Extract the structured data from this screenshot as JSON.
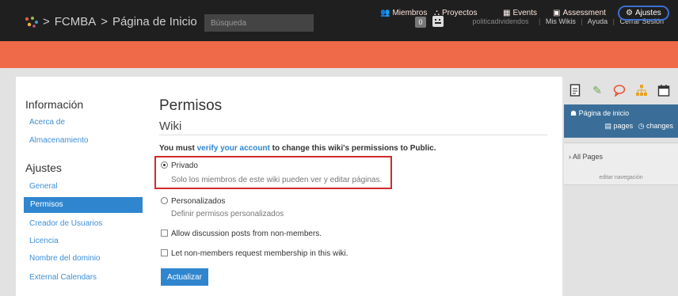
{
  "topbar": {
    "breadcrumb": [
      ">",
      "FCMBA",
      ">",
      "Página de Inicio"
    ],
    "search_placeholder": "Búsqueda",
    "notification_count": "0",
    "username": "politicadividendos",
    "links": [
      "Mis Wikis",
      "Ayuda",
      "Cerrar Sesión"
    ]
  },
  "nav": {
    "items": [
      "Miembros",
      "Proyectos",
      "Events",
      "Assessment",
      "Ajustes"
    ],
    "active": "Ajustes"
  },
  "sidebar": {
    "section1": "Información",
    "section1_items": [
      "Acerca de",
      "Almacenamiento"
    ],
    "section2": "Ajustes",
    "section2_items": [
      "General",
      "Permisos",
      "Creador de Usuarios",
      "Licencia",
      "Nombre del dominio",
      "External Calendars"
    ],
    "active": "Permisos"
  },
  "main": {
    "title": "Permisos",
    "subtitle": "Wiki",
    "notice_pre": "You must",
    "notice_link": "verify your account",
    "notice_post": "to change this wiki's permissions to Public.",
    "options": [
      {
        "label": "Privado",
        "description": "Solo los miembros de este wiki pueden ver y editar páginas.",
        "selected": true
      },
      {
        "label": "Personalizados",
        "description": "Definir permisos personalizados",
        "selected": false
      }
    ],
    "checkboxes": [
      {
        "label": "Allow discussion posts from non-members.",
        "checked": false
      },
      {
        "label": "Let non-members request membership in this wiki.",
        "checked": false
      }
    ],
    "submit_label": "Actualizar",
    "highlight_color": "#d12a2a"
  },
  "right_panel": {
    "icons": [
      "page-icon",
      "paperclip-icon",
      "speech-bubble-icon",
      "sitemap-icon",
      "calendar-icon"
    ],
    "home_label": "Página de inicio",
    "pages_label": "pages",
    "changes_label": "changes",
    "all_pages": "All Pages",
    "edit_nav": "editar navegación"
  },
  "colors": {
    "topbar": "#1f1f1f",
    "navbar": "#ef6a48",
    "accent": "#2f86cf",
    "active_nav_ring": "#3b6fd0"
  }
}
